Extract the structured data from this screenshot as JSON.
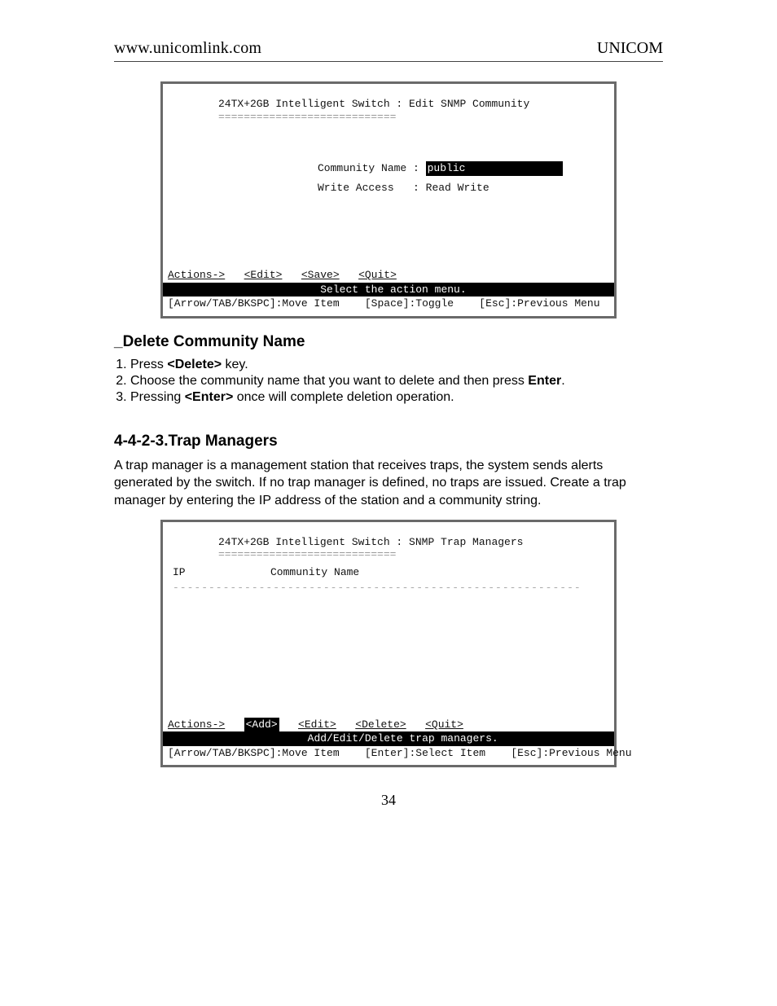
{
  "header": {
    "left": "www.unicomlink.com",
    "right": "UNICOM"
  },
  "terminal1": {
    "title": "24TX+2GB Intelligent Switch : Edit SNMP Community",
    "underline": "============================",
    "field1_label": "Community Name",
    "field1_value": "public",
    "field2_label": "Write Access",
    "field2_value": "Read Write",
    "actions_label": "Actions->",
    "action_edit": "<Edit>",
    "action_save": "<Save>",
    "action_quit": "<Quit>",
    "bar_text": "Select the action menu.",
    "bottom_move": "[Arrow/TAB/BKSPC]:Move Item",
    "bottom_toggle": "[Space]:Toggle",
    "bottom_prev": "[Esc]:Previous Menu"
  },
  "section_delete": {
    "heading": "_Delete Community Name",
    "step1_a": "Press ",
    "step1_b": "<Delete>",
    "step1_c": " key.",
    "step2_a": "Choose the community name that you want to delete and then press ",
    "step2_b": "Enter",
    "step2_c": ".",
    "step3_a": "Pressing ",
    "step3_b": "<Enter>",
    "step3_c": " once will complete deletion operation."
  },
  "section_trap": {
    "heading": "4-4-2-3.Trap Managers",
    "para": "A trap manager is a management station that receives traps, the system sends alerts generated by the switch. If no trap manager is defined, no traps are issued. Create a trap manager by entering the IP address of the station and a community string."
  },
  "terminal2": {
    "title": "24TX+2GB Intelligent Switch : SNMP Trap Managers",
    "underline": "============================",
    "col_ip": "IP",
    "col_comm": "Community Name",
    "actions_label": "Actions->",
    "action_add": "<Add>",
    "action_edit": "<Edit>",
    "action_delete": "<Delete>",
    "action_quit": "<Quit>",
    "bar_text": "Add/Edit/Delete trap managers.",
    "bottom_move": "[Arrow/TAB/BKSPC]:Move Item",
    "bottom_select": "[Enter]:Select Item",
    "bottom_prev": "[Esc]:Previous Menu"
  },
  "page_number": "34"
}
